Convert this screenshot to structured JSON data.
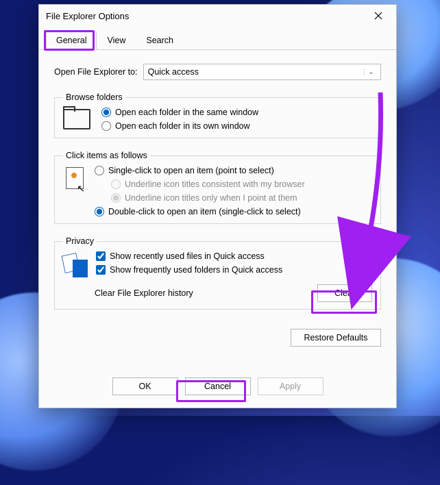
{
  "window": {
    "title": "File Explorer Options"
  },
  "tabs": {
    "general": "General",
    "view": "View",
    "search": "Search",
    "active": "general"
  },
  "open_row": {
    "label": "Open File Explorer to:",
    "value": "Quick access"
  },
  "browse_folders": {
    "legend": "Browse folders",
    "same_window": "Open each folder in the same window",
    "own_window": "Open each folder in its own window",
    "selected": "same_window"
  },
  "click_items": {
    "legend": "Click items as follows",
    "single": "Single-click to open an item (point to select)",
    "underline_browser": "Underline icon titles consistent with my browser",
    "underline_point": "Underline icon titles only when I point at them",
    "double": "Double-click to open an item (single-click to select)",
    "selected": "double",
    "underline_selected": "underline_point"
  },
  "privacy": {
    "legend": "Privacy",
    "recent": "Show recently used files in Quick access",
    "frequent": "Show frequently used folders in Quick access",
    "recent_checked": true,
    "frequent_checked": true,
    "history_label": "Clear File Explorer history",
    "clear_btn": "Clear"
  },
  "restore_btn": "Restore Defaults",
  "footer": {
    "ok": "OK",
    "cancel": "Cancel",
    "apply": "Apply"
  },
  "annotation": {
    "highlights": [
      "tab-general",
      "clear-button",
      "ok-button"
    ],
    "arrow": {
      "from": "top-right",
      "to": "clear-button",
      "color": "#a020f0"
    }
  }
}
